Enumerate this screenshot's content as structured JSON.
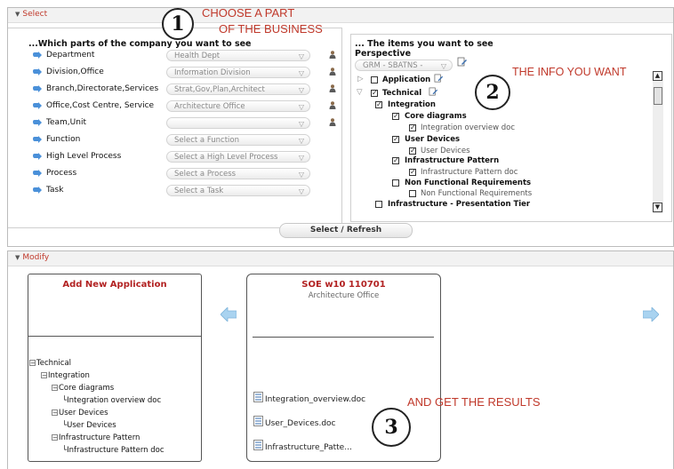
{
  "select_section": {
    "title": "Select"
  },
  "modify_section": {
    "title": "Modify"
  },
  "left_panel": {
    "heading": "...Which parts of the company you want to see",
    "rows": [
      {
        "label": "Department",
        "value": "Health Dept"
      },
      {
        "label": "Division,Office",
        "value": "Information Division"
      },
      {
        "label": "Branch,Directorate,Services",
        "value": "Strat,Gov,Plan,Architect"
      },
      {
        "label": "Office,Cost Centre, Service",
        "value": "Architecture Office"
      },
      {
        "label": "Team,Unit",
        "value": ""
      },
      {
        "label": "Function",
        "value": "Select a Function"
      },
      {
        "label": "High Level Process",
        "value": "Select a High Level Process"
      },
      {
        "label": "Process",
        "value": "Select a Process"
      },
      {
        "label": "Task",
        "value": "Select a Task"
      }
    ]
  },
  "right_panel": {
    "heading": "... The items you want to see",
    "perspective_label": "Perspective",
    "perspective_value": "GRM - SBATNS -",
    "tree": {
      "application": "Application",
      "technical": "Technical",
      "integration": "Integration",
      "core_diagrams": "Core diagrams",
      "integration_overview_doc": "Integration overview doc",
      "user_devices": "User Devices",
      "user_devices_sub": "User Devices",
      "infrastructure_pattern": "Infrastructure Pattern",
      "infrastructure_pattern_doc": "Infrastructure Pattern doc",
      "non_functional": "Non Functional Requirements",
      "non_functional_sub": "Non Functional Requirements",
      "infra_presentation": "Infrastructure - Presentation Tier"
    }
  },
  "refresh_button": "Select / Refresh",
  "annotations": {
    "badge1": "1",
    "choose_line1": "CHOOSE A PART",
    "choose_line2": "OF THE BUSINESS",
    "badge2": "2",
    "info": "THE INFO YOU WANT",
    "badge3": "3",
    "results": "AND GET THE RESULTS"
  },
  "add_card": {
    "title": "Add New Application",
    "tree": {
      "technical": "Technical",
      "integration": "Integration",
      "core_diagrams": "Core diagrams",
      "integration_overview_doc": "Integration overview doc",
      "user_devices": "User Devices",
      "user_devices_sub": "User Devices",
      "infrastructure_pattern": "Infrastructure Pattern",
      "infrastructure_pattern_doc": "Infrastructure Pattern doc"
    }
  },
  "soe_card": {
    "title": "SOE w10 110701",
    "subtitle": "Architecture Office",
    "docs": [
      "Integration_overview.doc",
      "User_Devices.doc",
      "Infrastructure_Patte..."
    ]
  },
  "colors": {
    "accent_red": "#c0392b",
    "arrow_blue": "#4a90d9"
  }
}
